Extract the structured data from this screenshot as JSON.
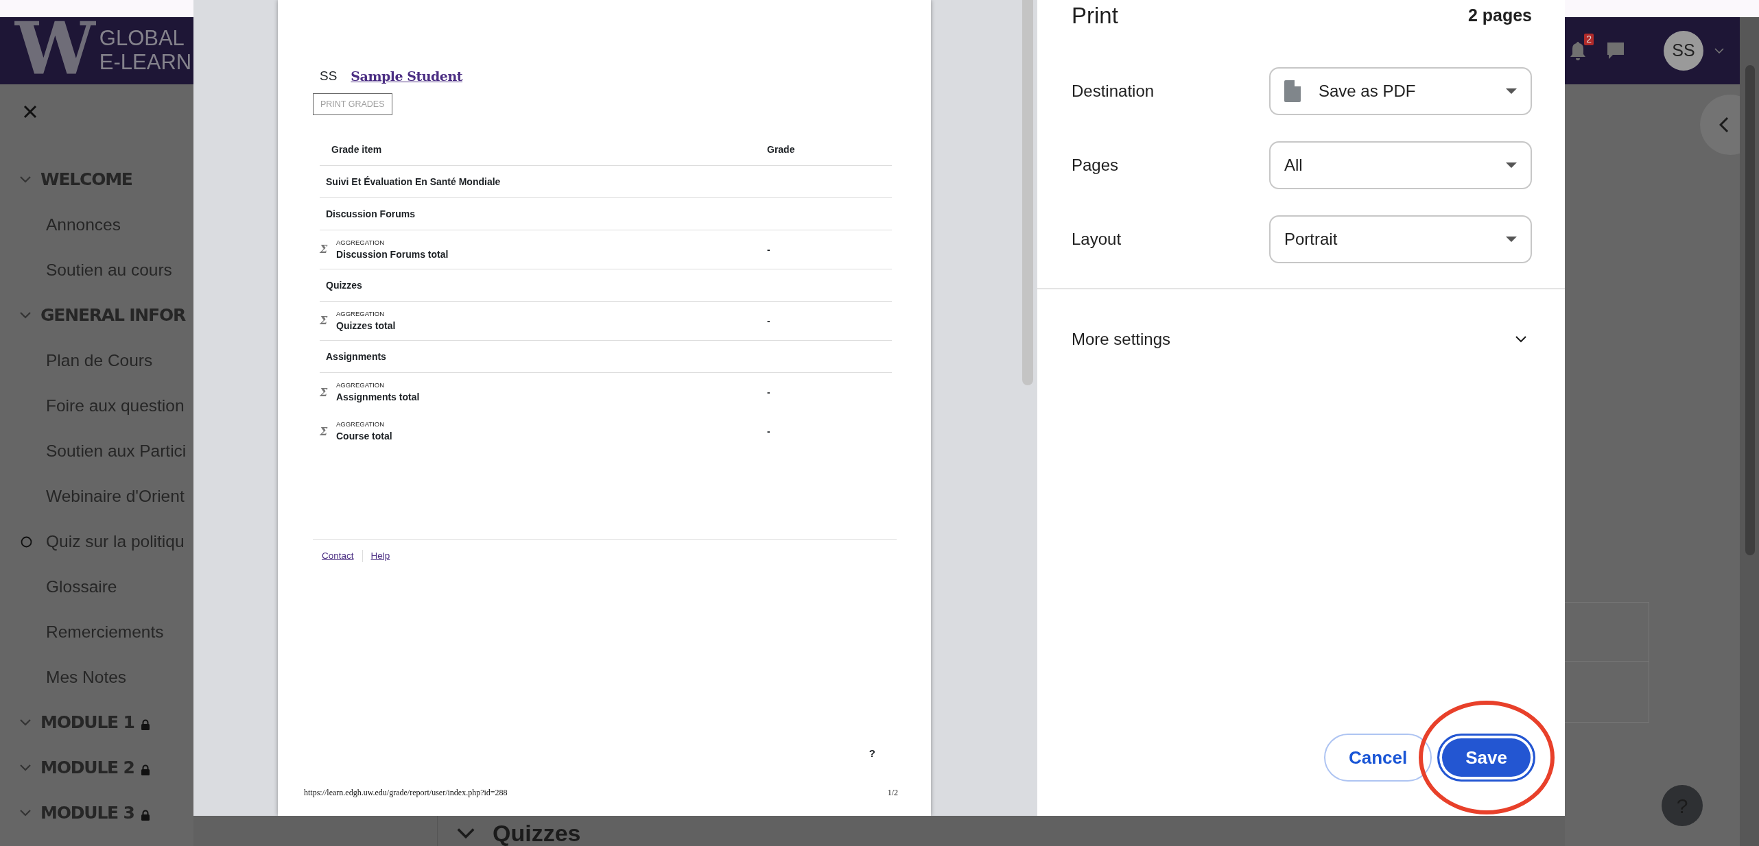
{
  "site": {
    "logo_mark": "W",
    "logo_lines": [
      "GLOBAL",
      "E-LEARN"
    ],
    "notification_count": "2",
    "avatar": "SS"
  },
  "sidebar": {
    "sections": [
      {
        "title": "WELCOME",
        "expanded": true,
        "items": [
          {
            "label": "Annonces",
            "kind": "page"
          },
          {
            "label": "Soutien au cours",
            "kind": "page"
          }
        ]
      },
      {
        "title": "GENERAL INFOR",
        "expanded": true,
        "items": [
          {
            "label": "Plan de Cours",
            "kind": "page"
          },
          {
            "label": "Foire aux question",
            "kind": "page"
          },
          {
            "label": "Soutien aux Partici",
            "kind": "page"
          },
          {
            "label": "Webinaire d'Orient",
            "kind": "page"
          },
          {
            "label": "Quiz sur la politiqu",
            "kind": "activity"
          },
          {
            "label": "Glossaire",
            "kind": "page"
          },
          {
            "label": "Remerciements",
            "kind": "page"
          },
          {
            "label": "Mes Notes",
            "kind": "page"
          }
        ]
      },
      {
        "title": "MODULE 1",
        "expanded": true,
        "locked": true
      },
      {
        "title": "MODULE 2",
        "expanded": true,
        "locked": true
      },
      {
        "title": "MODULE 3",
        "expanded": true,
        "locked": true
      }
    ]
  },
  "background_heading": {
    "title": "Quizzes",
    "expanded": true
  },
  "help_button": "?",
  "print_dialog": {
    "title": "Print",
    "page_count": "2 pages",
    "settings": [
      {
        "label": "Destination",
        "value": "Save as PDF",
        "kind": "destination"
      },
      {
        "label": "Pages",
        "value": "All",
        "kind": "select"
      },
      {
        "label": "Layout",
        "value": "Portrait",
        "kind": "select"
      }
    ],
    "more_settings": {
      "label": "More settings",
      "expanded": false
    },
    "buttons": [
      {
        "label": "Cancel",
        "kind": "secondary"
      },
      {
        "label": "Save",
        "kind": "primary"
      }
    ],
    "preview": {
      "initials": "SS",
      "student": "Sample Student",
      "print_button": "PRINT GRADES",
      "columns": [
        "Grade item",
        "Grade"
      ],
      "rows": [
        {
          "kind": "category",
          "item": "Suivi Et Évaluation En Santé Mondiale"
        },
        {
          "kind": "category",
          "item": "Discussion Forums"
        },
        {
          "kind": "aggregate",
          "symbol": "Σ",
          "tag": "AGGREGATION",
          "item": "Discussion Forums total",
          "grade": "-"
        },
        {
          "kind": "category",
          "item": "Quizzes"
        },
        {
          "kind": "aggregate",
          "symbol": "Σ",
          "tag": "AGGREGATION",
          "item": "Quizzes total",
          "grade": "-"
        },
        {
          "kind": "category",
          "item": "Assignments"
        },
        {
          "kind": "aggregate",
          "symbol": "Σ",
          "tag": "AGGREGATION",
          "item": "Assignments total",
          "grade": "-"
        },
        {
          "kind": "aggregate",
          "symbol": "Σ",
          "tag": "AGGREGATION",
          "item": "Course total",
          "grade": "-"
        }
      ],
      "footer_links": [
        "Contact",
        "Help"
      ],
      "help_mark": "?",
      "url": "https://learn.edgh.uw.edu/grade/report/user/index.php?id=288",
      "page_number": "1/2"
    }
  }
}
